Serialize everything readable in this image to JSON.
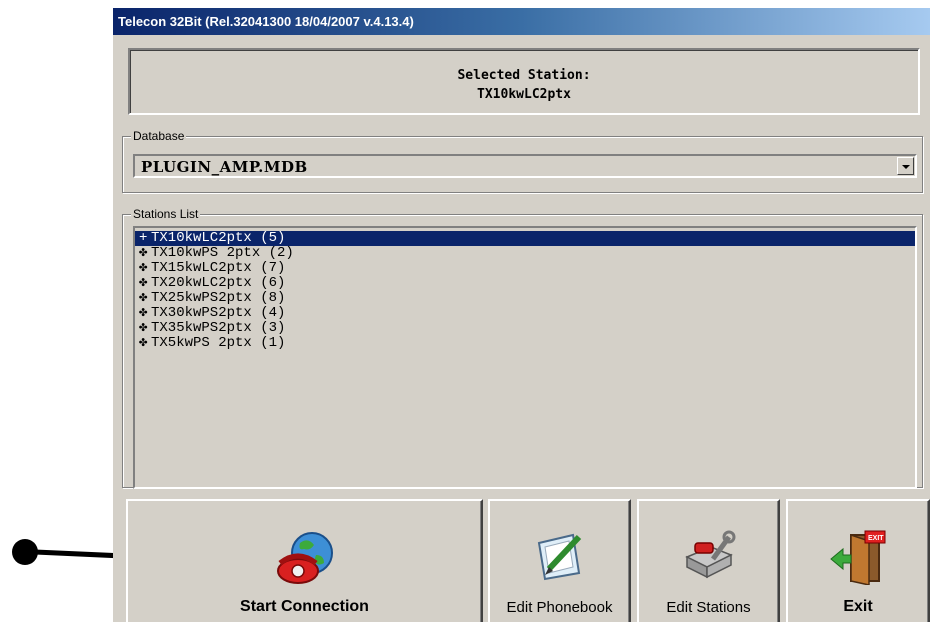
{
  "window": {
    "title": "Telecon 32Bit (Rel.32041300 18/04/2007 v.4.13.4)"
  },
  "selected_station": {
    "heading": "Selected Station:",
    "name": "TX10kwLC2ptx"
  },
  "database": {
    "label": "Database",
    "value": "PLUGIN_AMP.MDB"
  },
  "stations": {
    "label": "Stations List",
    "items": [
      "TX10kwLC2ptx (5)",
      "TX10kwPS 2ptx (2)",
      "TX15kwLC2ptx (7)",
      "TX20kwLC2ptx (6)",
      "TX25kwPS2ptx (8)",
      "TX30kwPS2ptx (4)",
      "TX35kwPS2ptx (3)",
      "TX5kwPS 2ptx (1)"
    ],
    "selected_index": 0
  },
  "buttons": {
    "start": "Start Connection",
    "phonebook": "Edit Phonebook",
    "stations": "Edit Stations",
    "exit": "Exit"
  },
  "icons": {
    "start": "globe-phone-icon",
    "phonebook": "phonebook-pencil-icon",
    "stations": "station-tools-icon",
    "exit": "exit-door-icon",
    "annotation": "callout-arrow"
  },
  "colors": {
    "title_start": "#0a246a",
    "title_end": "#a6caf0",
    "selection": "#0a246a",
    "face": "#d4d0c8"
  }
}
